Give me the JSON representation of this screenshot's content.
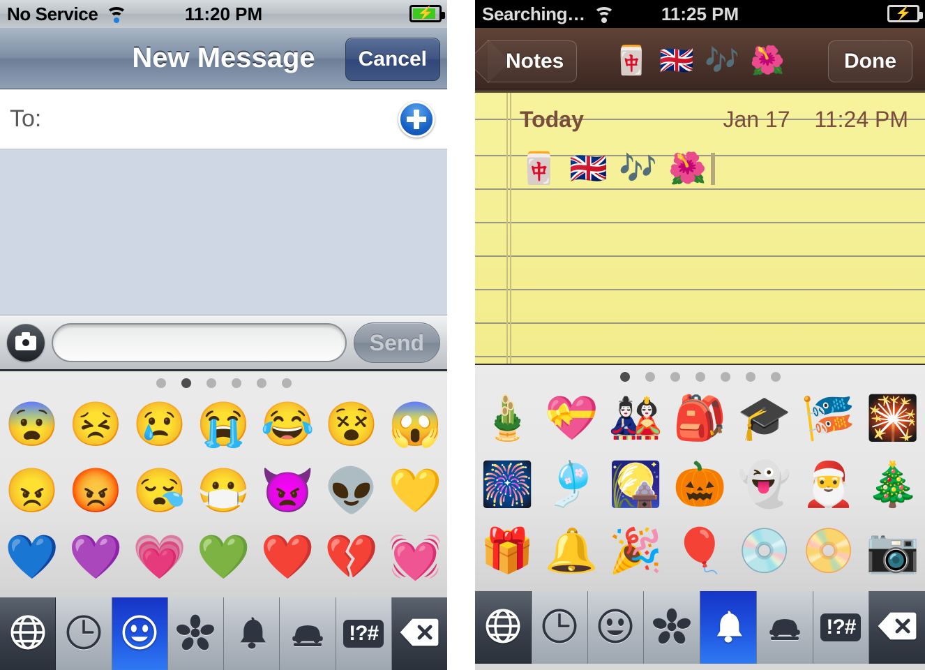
{
  "left_phone": {
    "status_bar": {
      "carrier": "No Service",
      "time": "11:20 PM",
      "wifi_icon": "wifi-icon",
      "battery_icon": "battery-charging-icon"
    },
    "nav_bar": {
      "title": "New Message",
      "cancel_label": "Cancel"
    },
    "to_field": {
      "label": "To:",
      "value": "",
      "add_contact_icon": "plus-circle-icon"
    },
    "compose_bar": {
      "camera_icon": "camera-icon",
      "input_value": "",
      "input_placeholder": "",
      "send_label": "Send"
    },
    "keyboard": {
      "page_dots": {
        "count": 6,
        "active_index": 1
      },
      "emoji_rows": [
        [
          "😨",
          "😣",
          "😢",
          "😭",
          "😂",
          "😵",
          "😱"
        ],
        [
          "😠",
          "😡",
          "😪",
          "😷",
          "👿",
          "👽",
          "💛"
        ],
        [
          "💙",
          "💜",
          "💗",
          "💚",
          "❤️",
          "💔",
          "💓"
        ]
      ],
      "emoji_names": [
        [
          "fearful-face",
          "persevering-face",
          "crying-face",
          "loudly-crying-face",
          "face-with-tears-of-joy",
          "dizzy-face",
          "screaming-face"
        ],
        [
          "angry-face",
          "pouting-face",
          "sleepy-face",
          "face-with-medical-mask",
          "angry-devil",
          "alien",
          "yellow-heart"
        ],
        [
          "blue-heart",
          "purple-heart",
          "growing-heart",
          "green-heart",
          "red-heart",
          "broken-heart",
          "beating-heart"
        ]
      ],
      "tabs": [
        {
          "name": "globe",
          "active": false,
          "dark": true
        },
        {
          "name": "clock",
          "active": false,
          "dark": false
        },
        {
          "name": "smiley",
          "active": true,
          "dark": false
        },
        {
          "name": "flower",
          "active": false,
          "dark": false
        },
        {
          "name": "bell",
          "active": false,
          "dark": false
        },
        {
          "name": "car",
          "active": false,
          "dark": false
        },
        {
          "name": "symbols",
          "active": false,
          "dark": false,
          "label": "!?#"
        },
        {
          "name": "delete",
          "active": false,
          "dark": true
        }
      ]
    }
  },
  "right_phone": {
    "status_bar": {
      "carrier": "Searching…",
      "time": "11:25 PM",
      "wifi_icon": "wifi-icon",
      "battery_icon": "battery-charging-icon"
    },
    "nav_bar": {
      "back_label": "Notes",
      "done_label": "Done",
      "title_emojis": "🀄 🇬🇧 🎶 🌺"
    },
    "note": {
      "title": "Today",
      "date": "Jan 17",
      "time": "11:24 PM",
      "body_emojis": "🀄 🇬🇧 🎶 🌺"
    },
    "keyboard": {
      "page_dots": {
        "count": 7,
        "active_index": 0
      },
      "emoji_rows": [
        [
          "🎍",
          "💝",
          "🎎",
          "🎒",
          "🎓",
          "🎏",
          "🎇"
        ],
        [
          "🎆",
          "🎐",
          "🎑",
          "🎃",
          "👻",
          "🎅",
          "🎄"
        ],
        [
          "🎁",
          "🔔",
          "🎉",
          "🎈",
          "💿",
          "📀",
          "📷"
        ]
      ],
      "emoji_names": [
        [
          "pine-decoration",
          "heart-with-ribbon",
          "japanese-dolls",
          "school-backpack",
          "graduation-cap",
          "carp-streamer",
          "sparkler"
        ],
        [
          "fireworks",
          "wind-chime",
          "moon-viewing-ceremony",
          "jack-o-lantern",
          "ghost",
          "santa-claus",
          "christmas-tree"
        ],
        [
          "wrapped-gift",
          "bell",
          "party-popper",
          "balloon",
          "optical-disk",
          "dvd",
          "camera"
        ]
      ],
      "tabs": [
        {
          "name": "globe",
          "active": false,
          "dark": true
        },
        {
          "name": "clock",
          "active": false,
          "dark": false
        },
        {
          "name": "smiley",
          "active": false,
          "dark": false
        },
        {
          "name": "flower",
          "active": false,
          "dark": false
        },
        {
          "name": "bell",
          "active": true,
          "dark": false
        },
        {
          "name": "car",
          "active": false,
          "dark": false
        },
        {
          "name": "symbols",
          "active": false,
          "dark": false,
          "label": "!?#"
        },
        {
          "name": "delete",
          "active": false,
          "dark": true
        }
      ]
    }
  },
  "colors": {
    "messages_nav": "#7e8ea5",
    "notes_nav": "#4e352c",
    "paper": "#f6f096",
    "note_text": "#7a4d3a",
    "accent_blue": "#1f56e2",
    "transcript_bg": "#ced7e3"
  }
}
